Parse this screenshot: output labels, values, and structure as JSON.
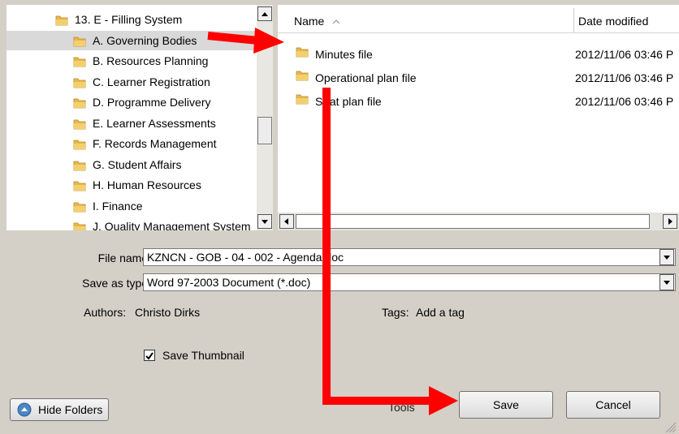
{
  "tree": {
    "items": [
      {
        "label": "13. E - Filling System",
        "selected": false
      },
      {
        "label": "A. Governing Bodies",
        "selected": true
      },
      {
        "label": "B. Resources Planning",
        "selected": false
      },
      {
        "label": "C. Learner Registration",
        "selected": false
      },
      {
        "label": "D. Programme Delivery",
        "selected": false
      },
      {
        "label": "E. Learner Assessments",
        "selected": false
      },
      {
        "label": "F. Records Management",
        "selected": false
      },
      {
        "label": "G. Student Affairs",
        "selected": false
      },
      {
        "label": "H. Human Resources",
        "selected": false
      },
      {
        "label": "I. Finance",
        "selected": false
      },
      {
        "label": "J. Quality Management System",
        "selected": false
      }
    ]
  },
  "list": {
    "columns": {
      "name": "Name",
      "date": "Date modified"
    },
    "rows": [
      {
        "name": "Minutes file",
        "date": "2012/11/06 03:46 P"
      },
      {
        "name": "Operational plan file",
        "date": "2012/11/06 03:46 P"
      },
      {
        "name": "Strat plan file",
        "date": "2012/11/06 03:46 P"
      }
    ]
  },
  "form": {
    "file_name_label": "File name:",
    "file_name_value": "KZNCN - GOB - 04 - 002 - Agenda.doc",
    "save_type_label": "Save as type:",
    "save_type_value": "Word 97-2003 Document (*.doc)",
    "authors_label": "Authors:",
    "authors_value": "Christo Dirks",
    "tags_label": "Tags:",
    "tags_value": "Add a tag",
    "thumbnail_label": "Save Thumbnail",
    "thumbnail_checked": true
  },
  "buttons": {
    "hide_folders": "Hide Folders",
    "tools": "Tools",
    "save": "Save",
    "cancel": "Cancel"
  },
  "colors": {
    "arrow": "#ff0000",
    "folder": "#e8b84a",
    "selection": "#d9d9d9"
  }
}
